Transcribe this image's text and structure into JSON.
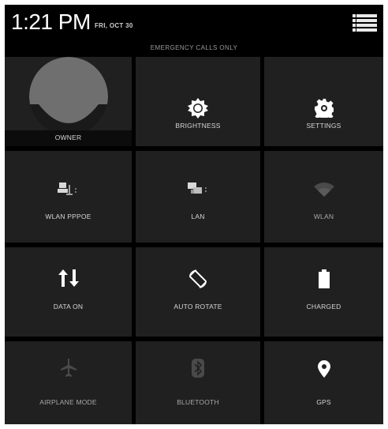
{
  "status_bar": {
    "time": "1:21 PM",
    "date": "FRI, OCT 30"
  },
  "notice": "EMERGENCY CALLS ONLY",
  "colors": {
    "background": "#000000",
    "tile": "#202020",
    "icon_active": "#ffffff",
    "icon_disabled": "#4a4a4a",
    "text": "#d6d6d6"
  },
  "tiles": [
    {
      "label": "OWNER",
      "icon": "avatar-icon",
      "active": true
    },
    {
      "label": "BRIGHTNESS",
      "icon": "brightness-icon",
      "active": true
    },
    {
      "label": "SETTINGS",
      "icon": "settings-icon",
      "active": true
    },
    {
      "label": "WLAN PPPOE",
      "icon": "wlan-pppoe-icon",
      "active": true
    },
    {
      "label": "LAN",
      "icon": "lan-icon",
      "active": true
    },
    {
      "label": "WLAN",
      "icon": "wifi-icon",
      "active": false
    },
    {
      "label": "DATA ON",
      "icon": "data-arrows-icon",
      "active": true
    },
    {
      "label": "AUTO ROTATE",
      "icon": "auto-rotate-icon",
      "active": true
    },
    {
      "label": "CHARGED",
      "icon": "battery-icon",
      "active": true
    },
    {
      "label": "AIRPLANE MODE",
      "icon": "airplane-icon",
      "active": false
    },
    {
      "label": "BLUETOOTH",
      "icon": "bluetooth-icon",
      "active": false
    },
    {
      "label": "GPS",
      "icon": "location-pin-icon",
      "active": true
    }
  ]
}
